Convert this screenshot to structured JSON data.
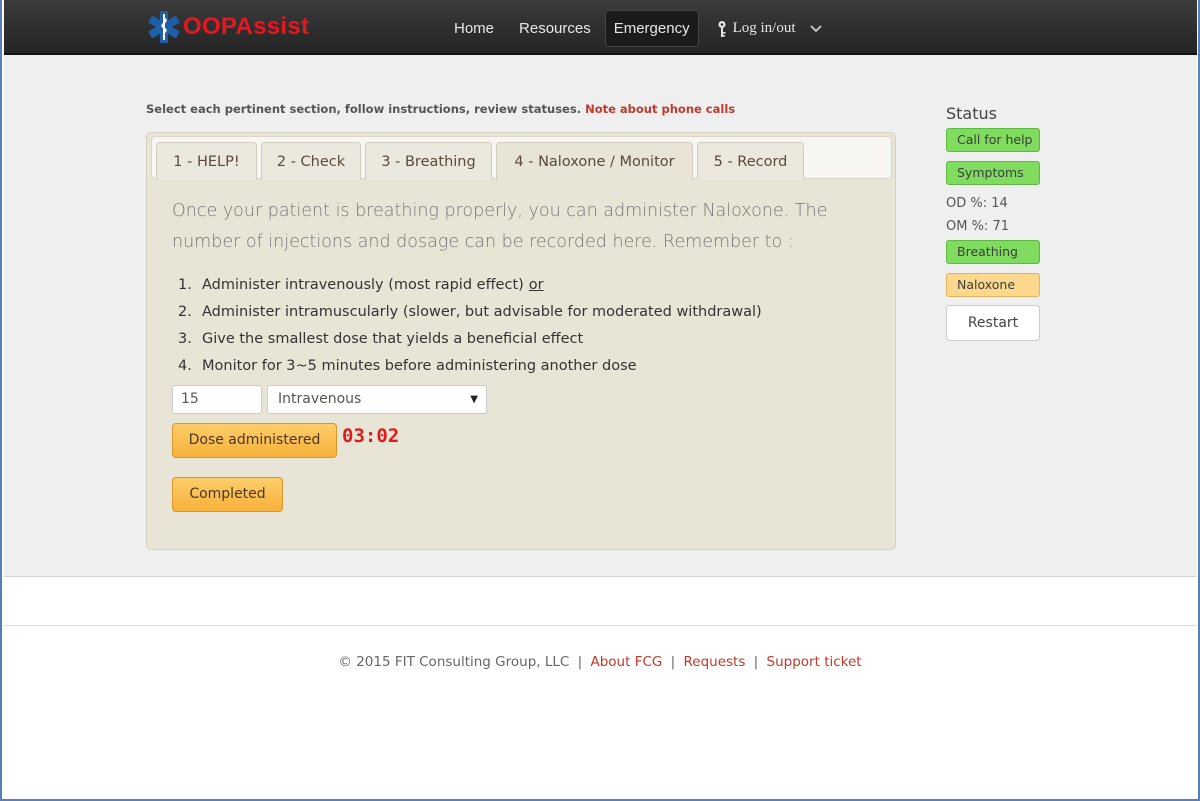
{
  "header": {
    "brand": "OOPAssist",
    "nav": [
      "Home",
      "Resources",
      "Emergency"
    ],
    "login_label": "Log in/out"
  },
  "intro": {
    "text": "Select each pertinent section, follow instructions, review statuses.",
    "note_link": "Note about phone calls"
  },
  "tabs": [
    "1 - HELP!",
    "2 - Check",
    "3 - Breathing",
    "4 - Naloxone / Monitor",
    "5 - Record"
  ],
  "active_tab": "4 - Naloxone / Monitor",
  "content": {
    "description": "Once your patient is breathing properly, you can administer Naloxone. The number of injections and dosage can be recorded here. Remember to :",
    "steps": [
      {
        "num": "1.",
        "text": "Administer intravenously (most rapid effect)",
        "suffix": "or"
      },
      {
        "num": "2.",
        "text": "Administer intramuscularly (slower, but advisable for moderated withdrawal)",
        "suffix": ""
      },
      {
        "num": "3.",
        "text": "Give the smallest dose that yields a beneficial effect",
        "suffix": ""
      },
      {
        "num": "4.",
        "text": "Monitor for 3~5 minutes before administering another dose",
        "suffix": ""
      }
    ],
    "dose_value": "15",
    "route_selected": "Intravenous",
    "dose_button": "Dose administered",
    "timer": "03:02",
    "completed_button": "Completed"
  },
  "status": {
    "title": "Status",
    "badges": [
      {
        "label": "Call for help",
        "state": "green"
      },
      {
        "label": "Symptoms",
        "state": "green"
      },
      {
        "label": "Breathing",
        "state": "green"
      },
      {
        "label": "Naloxone",
        "state": "orange"
      }
    ],
    "od": "OD %: 14",
    "om": "OM %: 71",
    "restart_label": "Restart"
  },
  "footer": {
    "copyright": "© 2015 FIT Consulting Group, LLC",
    "links": [
      "About FCG",
      "Requests",
      "Support ticket"
    ]
  },
  "colors": {
    "brand_red": "#e8161e",
    "accent_orange": "#f8b13b",
    "status_green": "#7fdc5e",
    "status_orange": "#fcd88c",
    "link_red": "#c0392b"
  },
  "icons": {
    "brand_logo": "star-of-life-icon",
    "login": "key-icon",
    "dropdown": "chevron-down-icon"
  }
}
